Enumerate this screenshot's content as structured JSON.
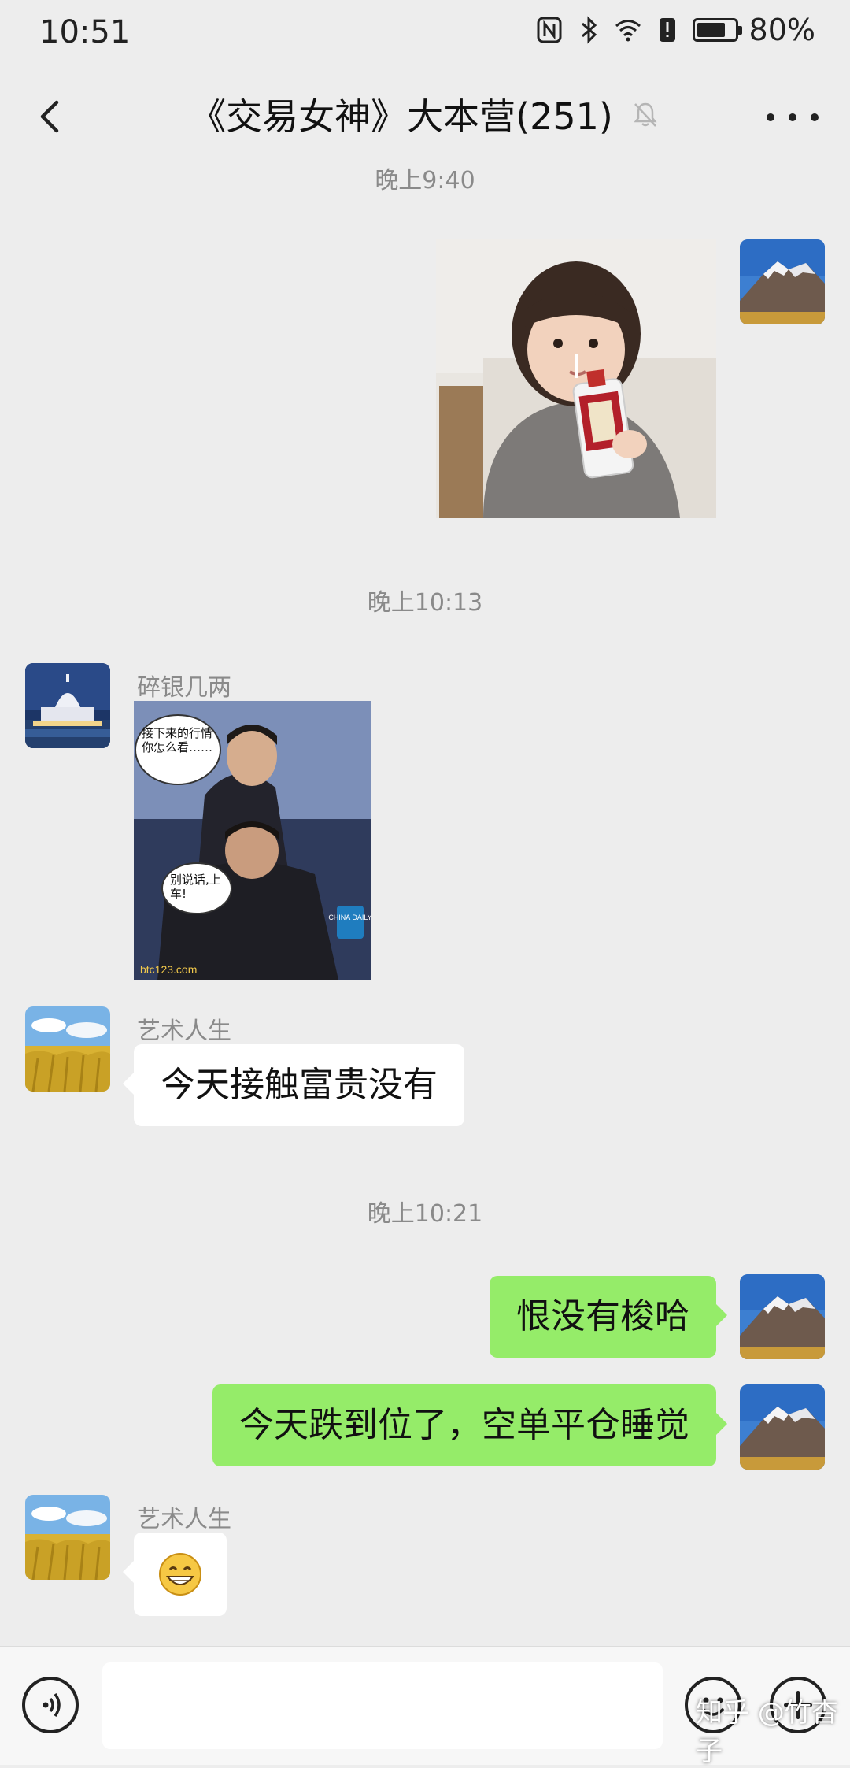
{
  "status_bar": {
    "time": "10:51",
    "battery": "80%",
    "battery_level": 0.8
  },
  "header": {
    "title": "《交易女神》大本营(251)"
  },
  "messages": [
    {
      "type": "time",
      "text": "晚上9:40"
    },
    {
      "type": "image",
      "side": "right",
      "sender_avatar": "mountain"
    },
    {
      "type": "time",
      "text": "晚上10:13"
    },
    {
      "type": "image",
      "side": "left",
      "sender": "碎银几两",
      "sender_avatar": "capitol",
      "image_text": {
        "bubble1": "接下来的行情你怎么看……",
        "bubble2": "别说话,上车!",
        "badge": "CHINA DAILY",
        "watermark": "btc123.com"
      }
    },
    {
      "type": "text",
      "side": "left",
      "sender": "艺术人生",
      "sender_avatar": "wheat",
      "text": "今天接触富贵没有"
    },
    {
      "type": "time",
      "text": "晚上10:21"
    },
    {
      "type": "text",
      "side": "right",
      "sender_avatar": "mountain",
      "text": "恨没有梭哈"
    },
    {
      "type": "text",
      "side": "right",
      "sender_avatar": "mountain",
      "text": "今天跌到位了，空单平仓睡觉"
    },
    {
      "type": "emoji",
      "side": "left",
      "sender": "艺术人生",
      "sender_avatar": "wheat",
      "text": "😁"
    }
  ],
  "input": {
    "value": "",
    "watermark": "知乎 @竹杳子"
  },
  "icons": {
    "back": "chevron-left-icon",
    "mute": "bell-off-icon",
    "more": "more-dots-icon",
    "voice": "voice-icon",
    "emoji": "emoji-icon",
    "plus": "plus-icon"
  },
  "colors": {
    "background": "#ededed",
    "bubble_self": "#95ec69",
    "bubble_other": "#ffffff",
    "meta_text": "#8a8a8a"
  }
}
